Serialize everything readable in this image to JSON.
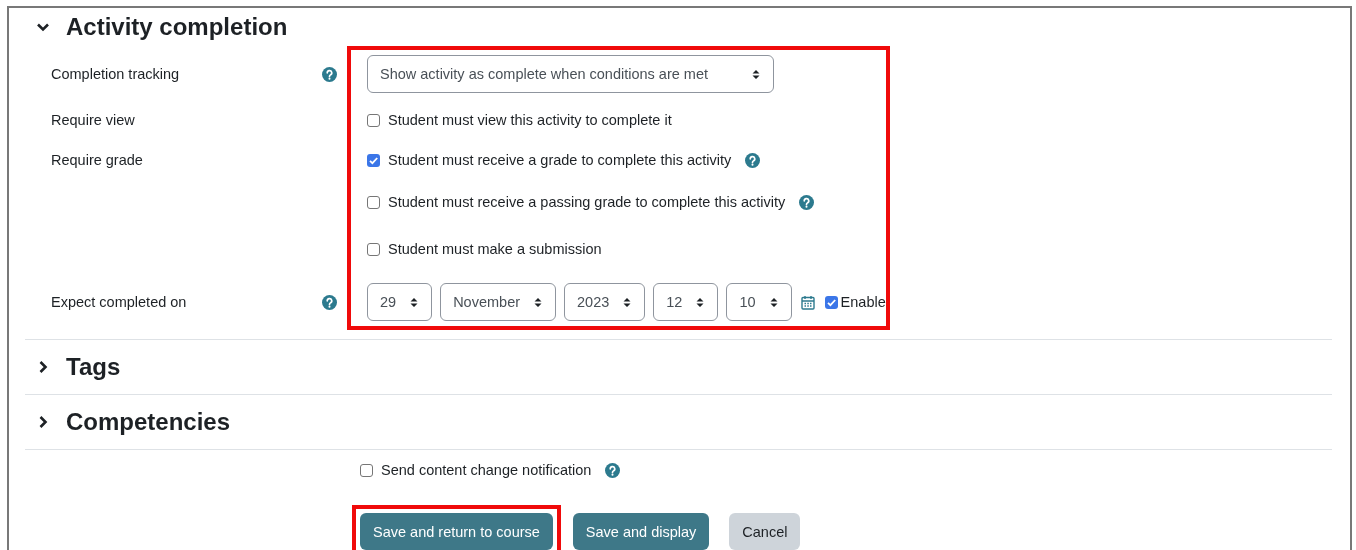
{
  "sections": [
    {
      "title": "Activity completion",
      "expanded": true,
      "highlighted": true,
      "rows": [
        {
          "kind": "select",
          "label": "Completion tracking",
          "label_help": true,
          "value": "Show activity as complete when conditions are met"
        },
        {
          "kind": "checkbox",
          "label": "Require view",
          "label_help": false,
          "text": "Student must view this activity to complete it",
          "checked": false,
          "help": false
        },
        {
          "kind": "checkbox",
          "label": "Require grade",
          "label_help": false,
          "text": "Student must receive a grade to complete this activity",
          "checked": true,
          "help": true
        },
        {
          "kind": "checkbox",
          "label_help": false,
          "text": "Student must receive a passing grade to complete this activity",
          "checked": false,
          "help": true
        },
        {
          "kind": "checkbox",
          "label_help": false,
          "text": "Student must make a submission",
          "checked": false,
          "help": false
        },
        {
          "kind": "date",
          "label": "Expect completed on",
          "label_help": true,
          "fields": [
            "29",
            "November",
            "2023",
            "12",
            "10"
          ],
          "enable": {
            "text": "Enable",
            "checked": true
          }
        }
      ]
    },
    {
      "title": "Tags",
      "expanded": false,
      "highlighted": false
    },
    {
      "title": "Competencies",
      "expanded": false,
      "highlighted": false
    }
  ],
  "notification": {
    "text": "Send content change notification",
    "checked": false,
    "help": true
  },
  "buttons": [
    {
      "label": "Save and return to course",
      "kind": "primary",
      "highlighted": true
    },
    {
      "label": "Save and display",
      "kind": "primary",
      "highlighted": false
    },
    {
      "label": "Cancel",
      "kind": "secondary",
      "highlighted": false
    }
  ]
}
